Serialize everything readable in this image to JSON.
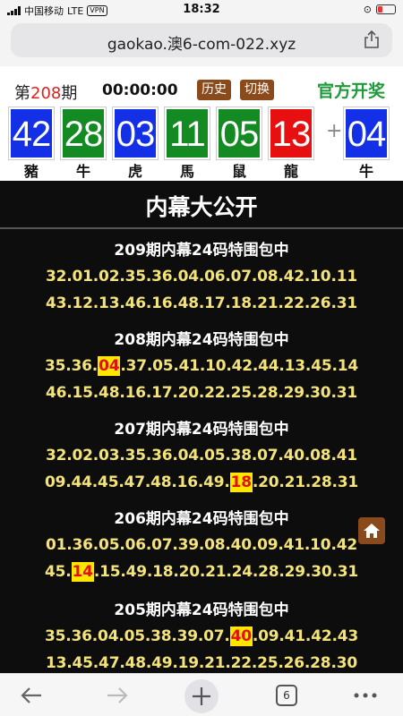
{
  "status": {
    "carrier": "中国移动",
    "network": "LTE",
    "vpn": "VPN",
    "time": "18:32"
  },
  "browser": {
    "url": "gaokao.澳6-com-022.xyz",
    "tab_count": "6"
  },
  "header": {
    "issue_prefix": "第",
    "issue_number": "208",
    "issue_suffix": "期",
    "timer": "00:00:00",
    "history_label": "历史",
    "switch_label": "切换",
    "official_label": "官方开奖"
  },
  "draw": {
    "balls": [
      {
        "number": "42",
        "zodiac": "豬",
        "color": "#1330e6"
      },
      {
        "number": "28",
        "zodiac": "牛",
        "color": "#148a22"
      },
      {
        "number": "03",
        "zodiac": "虎",
        "color": "#1330e6"
      },
      {
        "number": "11",
        "zodiac": "馬",
        "color": "#148a22"
      },
      {
        "number": "05",
        "zodiac": "鼠",
        "color": "#148a22"
      },
      {
        "number": "13",
        "zodiac": "龍",
        "color": "#e61010"
      }
    ],
    "plus": "+",
    "special": {
      "number": "04",
      "zodiac": "牛",
      "color": "#1330e6"
    }
  },
  "content": {
    "title": "内幕大公开",
    "blocks": [
      {
        "title": "209期内幕24码特围包中",
        "line1": "32.01.02.35.36.04.06.07.08.42.10.11",
        "line2": "43.12.13.46.16.48.17.18.21.22.26.31",
        "hit_line": 0,
        "hit_before": "",
        "hit": "",
        "hit_after": ""
      },
      {
        "title": "208期内幕24码特围包中",
        "line1_before": "35.36.",
        "line1_hit": "04",
        "line1_after": ".37.05.41.10.42.44.13.45.14",
        "line2": "46.15.48.16.17.20.22.25.28.29.30.31"
      },
      {
        "title": "207期内幕24码特围包中",
        "line1": "32.02.03.35.36.04.05.38.07.40.08.41",
        "line2_before": "09.44.45.47.48.16.49.",
        "line2_hit": "18",
        "line2_after": ".20.21.28.31"
      },
      {
        "title": "206期内幕24码特围包中",
        "line1": "01.36.05.06.07.39.08.40.09.41.10.42",
        "line2_before": "45.",
        "line2_hit": "14",
        "line2_after": ".15.49.18.20.21.24.28.29.30.31"
      },
      {
        "title": "205期内幕24码特围包中",
        "line1_before": "35.36.04.05.38.39.07.",
        "line1_hit": "40",
        "line1_after": ".09.41.42.43",
        "line2": "13.45.47.48.49.19.21.22.25.26.28.30"
      }
    ]
  },
  "colors": {
    "red": "#e61010",
    "green": "#148a22",
    "blue": "#1330e6",
    "button_brown": "#8b4a1c",
    "number_yellow": "#f3e37a",
    "highlight": "#ffe600"
  }
}
